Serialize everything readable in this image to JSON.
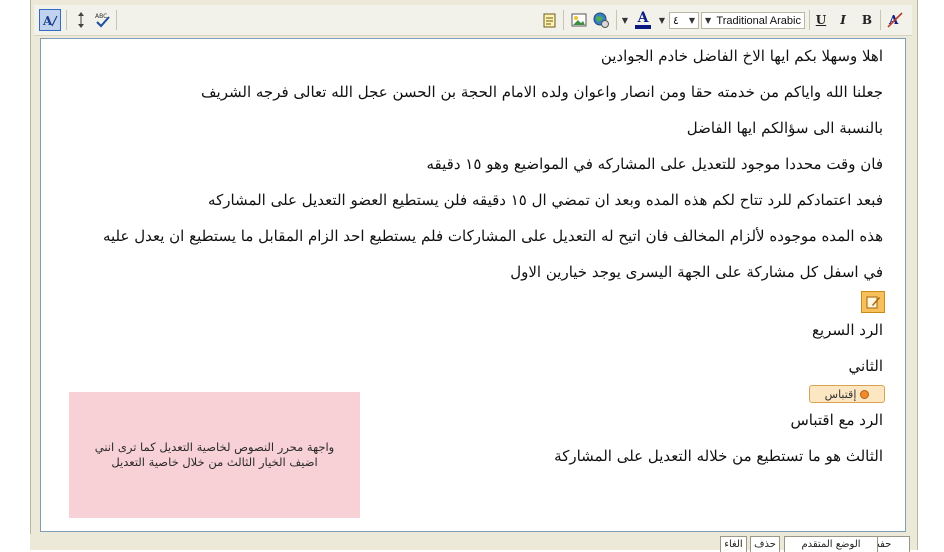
{
  "toolbar": {
    "font_name": "Traditional Arabic",
    "font_size": "٤",
    "font_color_letter": "A",
    "bold": "B",
    "italic": "I",
    "underline": "U",
    "spell_label": "ABC",
    "icons": [
      "switch-mode-icon",
      "resize-arrows-icon",
      "spellcheck-icon",
      "paste-text-icon",
      "insert-image-icon",
      "insert-link-icon",
      "font-color-icon",
      "clear-format-icon"
    ]
  },
  "content": {
    "lines": [
      "اهلا وسهلا بكم ايها الاخ الفاضل خادم الجوادين",
      "جعلنا الله واياكم من خدمته حقا ومن انصار واعوان ولده الامام الحجة بن الحسن عجل الله تعالى فرجه الشريف",
      "بالنسبة الى سؤالكم ايها الفاضل",
      "فان وقت محددا موجود للتعديل على المشاركه في المواضيع وهو ١٥ دقيقه",
      "فبعد اعتمادكم للرد تتاح لكم هذه المده وبعد ان تمضي ال ١٥ دقيقه فلن يستطيع العضو التعديل على المشاركه",
      "هذه المده موجوده لألزام المخالف فان اتيح له التعديل على المشاركات فلم يستطيع احد الزام المقابل ما يستطيع ان يعدل عليه",
      "في اسفل كل مشاركة على الجهة اليسرى يوجد خيارين الاول"
    ],
    "quick_reply_label": "الرد السريع",
    "second_label": "الثاني",
    "quote_button_label": "إقتباس",
    "reply_with_quote_label": "الرد مع اقتباس",
    "third_line": "الثالث هو ما تستطيع من خلاله التعديل على المشاركة"
  },
  "note": {
    "text": "واجهة محرر النصوص لخاصية التعديل كما ترى انني اضيف الخيار الثالث من خلال خاصية التعديل"
  },
  "bottom_buttons": {
    "save": "حفظ",
    "advanced": "الوضع المتقدم",
    "delete": "حذف",
    "cancel": "الغاء"
  }
}
